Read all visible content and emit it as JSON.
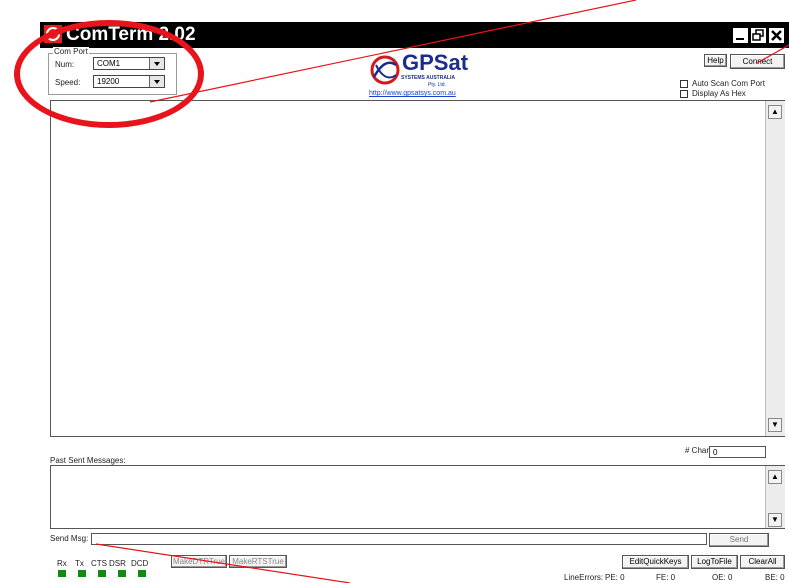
{
  "window": {
    "title": "ComTerm 2.02",
    "minimize_label": "_",
    "close_label": "✕"
  },
  "comport": {
    "group_label": "Com Port",
    "num_label": "Num:",
    "num_value": "COM1",
    "speed_label": "Speed:",
    "speed_value": "19200"
  },
  "logo": {
    "brand": "GPSat",
    "tagline": "SYSTEMS AUSTRALIA",
    "suffix": "Pty. Ltd.",
    "url": "http://www.gpsatsys.com.au"
  },
  "buttons": {
    "help": "Help",
    "connect": "Connect",
    "send": "Send",
    "make_dtr": "MakeDTRTrue",
    "make_rts": "MakeRTSTrue",
    "edit_quick_keys": "EditQuickKeys",
    "log_to_file": "LogToFile",
    "clear_all": "ClearAll"
  },
  "options": {
    "auto_scan": "Auto Scan Com Port",
    "display_hex": "Display As Hex"
  },
  "labels": {
    "past_sent": "Past Sent Messages:",
    "chars": "# Chars:",
    "chars_value": "0",
    "send_msg": "Send Msg:"
  },
  "signals": [
    "Rx",
    "Tx",
    "CTS",
    "DSR",
    "DCD"
  ],
  "line_errors": {
    "label": "LineErrors:",
    "pe": "PE: 0",
    "fe": "FE: 0",
    "oe": "OE: 0",
    "be": "BE: 0"
  },
  "colors": {
    "annotation": "#e8141c",
    "led": "#118a11",
    "logo_blue": "#1c2c8c"
  }
}
